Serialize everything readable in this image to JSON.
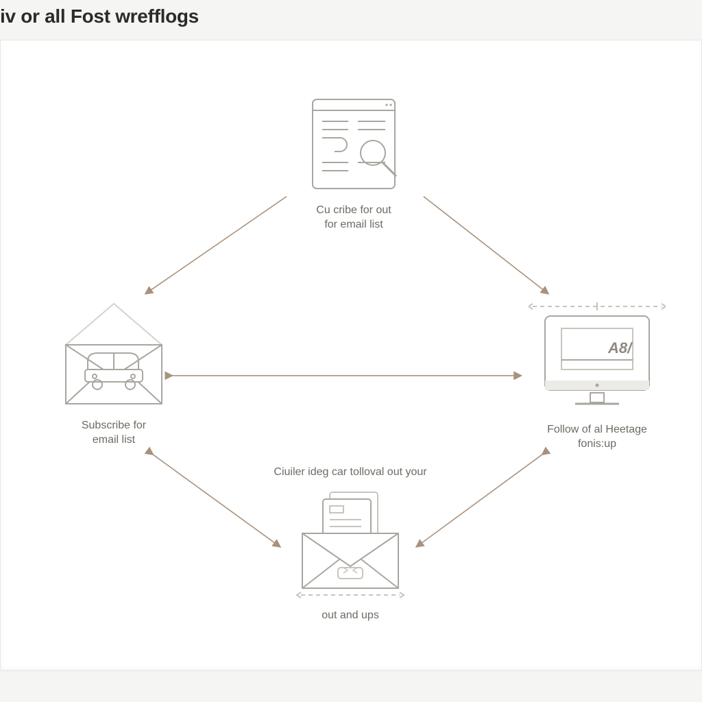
{
  "title": "iv or all Fost wrefflogs",
  "nodes": {
    "top": {
      "label_line1": "Cu cribe for out",
      "label_line2": "for email list"
    },
    "left": {
      "label_line1": "Subscribe for",
      "label_line2": "email list"
    },
    "right": {
      "label_line1": "Follow of al Heetage",
      "label_line2": "fonis:up"
    },
    "bottom": {
      "label_top": "Ciuiler ideg car tolloval out your",
      "label_bottom": "out and ups"
    }
  },
  "colors": {
    "icon_stroke": "#a9a6a0",
    "icon_light": "#d6d3cd",
    "arrow": "#a8927d",
    "text": "#6e6a63"
  }
}
